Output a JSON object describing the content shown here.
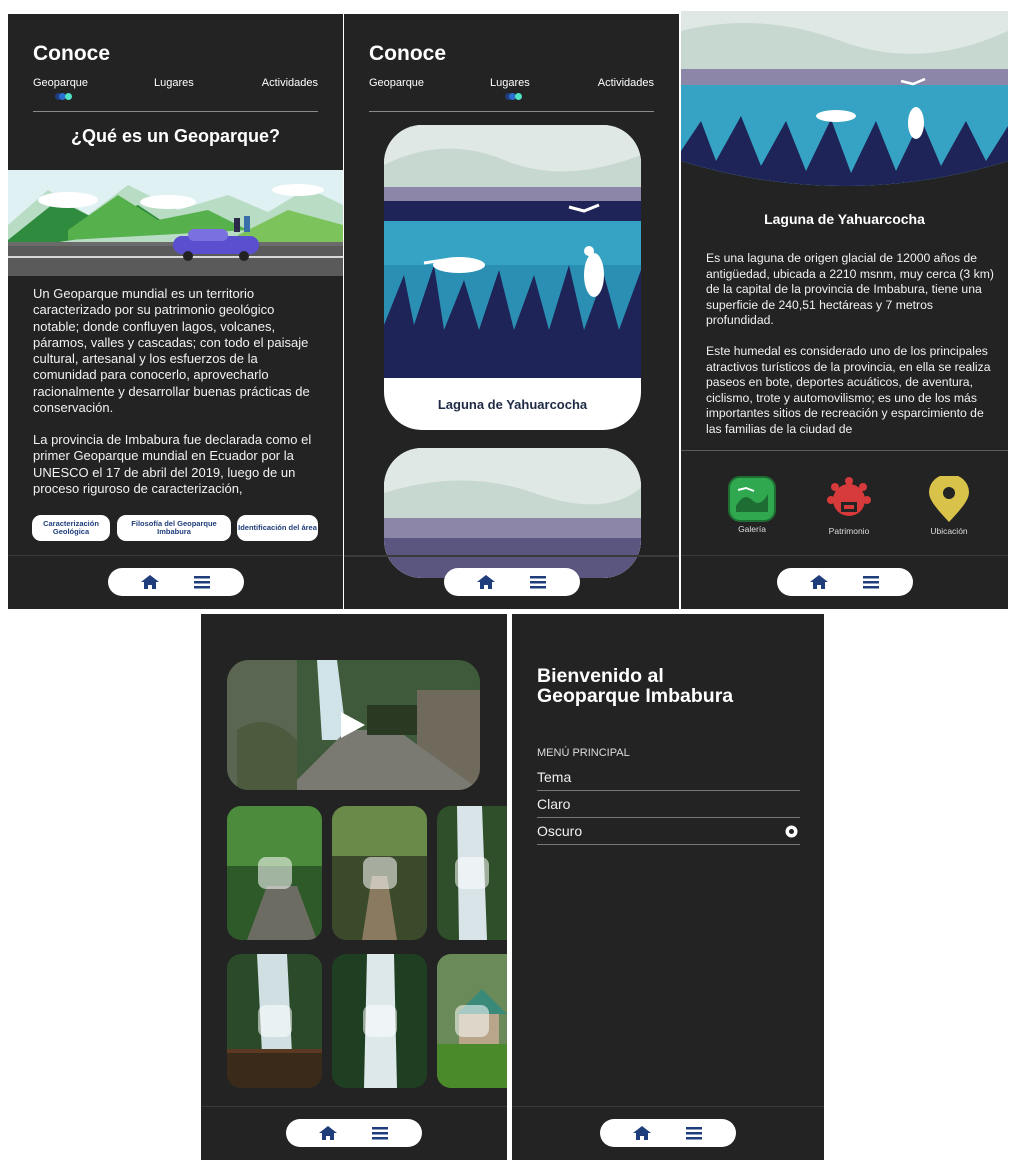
{
  "screen1": {
    "title": "Conoce",
    "tabs": [
      "Geoparque",
      "Lugares",
      "Actividades"
    ],
    "heading": "¿Qué es un Geoparque?",
    "paragraph1": "Un Geoparque mundial es un territorio caracterizado por su patrimonio geológico notable; donde confluyen lagos, volcanes, páramos, valles y cascadas; con todo el paisaje cultural, artesanal y los esfuerzos de la comunidad para conocerlo, aprovecharlo racionalmente y desarrollar buenas prácticas de conservación.",
    "paragraph2": "La provincia de Imbabura fue declarada como el primer Geoparque mundial en Ecuador por la UNESCO el 17 de abril del 2019, luego de un proceso riguroso de caracterización, documentación, difusión y",
    "chips": [
      "Caracterización Geológica",
      "Filosofía del Geoparque Imbabura",
      "Identificación del área"
    ]
  },
  "screen2": {
    "title": "Conoce",
    "tabs": [
      "Geoparque",
      "Lugares",
      "Actividades"
    ],
    "card_label": "Laguna de Yahuarcocha"
  },
  "screen3": {
    "heading": "Laguna de Yahuarcocha",
    "paragraph1": "Es una laguna de origen glacial de 12000 años de antigüedad, ubicada a 2210 msnm, muy cerca (3 km) de la capital de la provincia de Imbabura, tiene una superficie de 240,51 hectáreas y 7 metros profundidad.",
    "paragraph2": "Este humedal es considerado uno de los principales atractivos turísticos de la provincia, en ella se realiza paseos en bote, deportes acuáticos, de aventura, ciclismo, trote y automovilismo; es uno de los más importantes sitios de recreación y esparcimiento de las familias de la ciudad de",
    "features": [
      {
        "label": "Galería",
        "icon": "gallery-icon"
      },
      {
        "label": "Patrimonio",
        "icon": "heritage-icon"
      },
      {
        "label": "Ubicación",
        "icon": "location-pin-icon"
      }
    ]
  },
  "screen5": {
    "heading": "Bienvenido al Geoparque Imbabura",
    "section": "MENÚ PRINCIPAL",
    "items": [
      "Tema",
      "Claro",
      "Oscuro"
    ],
    "selected": "Oscuro"
  },
  "colors": {
    "background": "#232323",
    "accent_teal": "#4fe3c4",
    "accent_navy": "#1f3d7a",
    "gallery_green": "#2fa84f",
    "heritage_red": "#d73a3a",
    "location_yellow": "#d8c24a"
  }
}
